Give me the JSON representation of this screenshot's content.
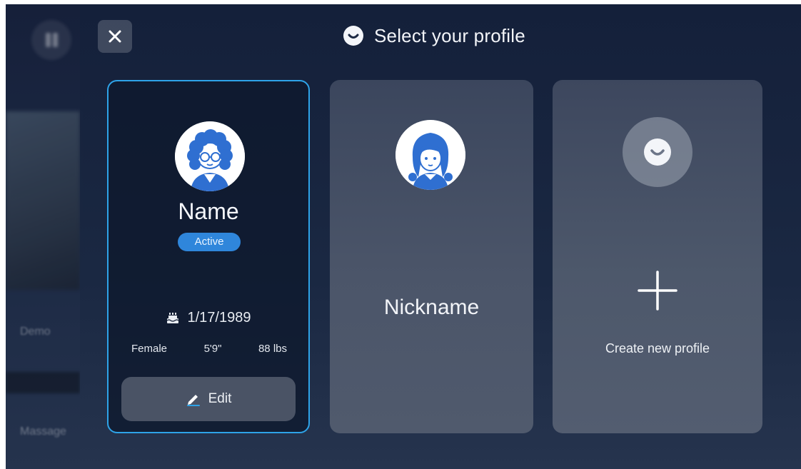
{
  "background": {
    "demo_label": "Demo",
    "massage_label": "Massage"
  },
  "header": {
    "title": "Select your profile",
    "close_icon": "close-icon",
    "title_icon": "smile-icon"
  },
  "profiles": [
    {
      "name": "Name",
      "status": "Active",
      "birthday": "1/17/1989",
      "birthday_icon": "cake-icon",
      "gender": "Female",
      "height": "5'9\"",
      "weight": "88 lbs",
      "edit_label": "Edit",
      "edit_icon": "pencil-icon",
      "selected": true
    },
    {
      "name": "Nickname",
      "selected": false
    }
  ],
  "create": {
    "label": "Create new profile",
    "icon": "plus-icon"
  },
  "colors": {
    "accent": "#2ea3e8",
    "badge": "#2f86db",
    "avatar_blue": "#2f6fd1"
  }
}
